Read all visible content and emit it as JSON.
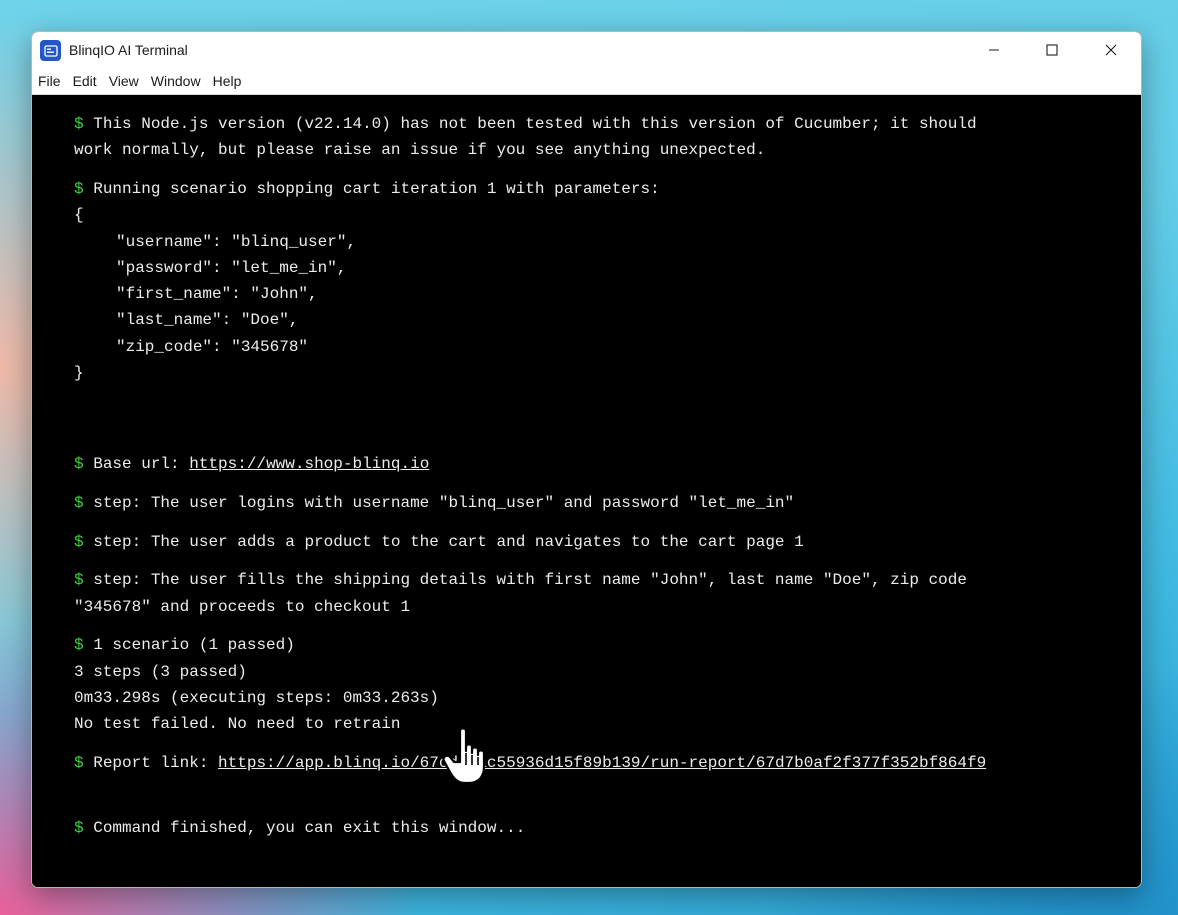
{
  "window": {
    "title": "BlinqIO AI Terminal"
  },
  "menu": [
    "File",
    "Edit",
    "View",
    "Window",
    "Help"
  ],
  "terminal": {
    "prompt": "$",
    "warning_line1": "This Node.js version (v22.14.0) has not been tested with this version of Cucumber; it should",
    "warning_line2": "work normally, but please raise an issue if you see anything unexpected.",
    "running": "Running scenario shopping cart iteration 1 with parameters:",
    "brace_open": "{",
    "params": [
      "\"username\": \"blinq_user\",",
      "\"password\": \"let_me_in\",",
      "\"first_name\": \"John\",",
      "\"last_name\": \"Doe\",",
      "\"zip_code\": \"345678\""
    ],
    "brace_close": "}",
    "base_url_label": "Base url:",
    "base_url": "https://www.shop-blinq.io",
    "step1": "step: The user logins with username \"blinq_user\" and password \"let_me_in\"",
    "step2": "step: The user adds a product to the cart and navigates to the cart page 1",
    "step3_line1": "step: The user fills the shipping details with first name \"John\", last name \"Doe\", zip code",
    "step3_line2": "\"345678\" and proceeds to checkout 1",
    "summary1": "1 scenario (1 passed)",
    "summary2": "3 steps (3 passed)",
    "summary3": "0m33.298s (executing steps: 0m33.263s)",
    "summary4": "No test failed. No need to retrain",
    "report_label": "Report link:",
    "report_url": "https://app.blinq.io/67cd87ac55936d15f89b139/run-report/67d7b0af2f377f352bf864f9",
    "finished": "Command finished, you can exit this window..."
  },
  "colors": {
    "prompt": "#3fcf3f",
    "text": "#ececec",
    "background": "#000000"
  }
}
